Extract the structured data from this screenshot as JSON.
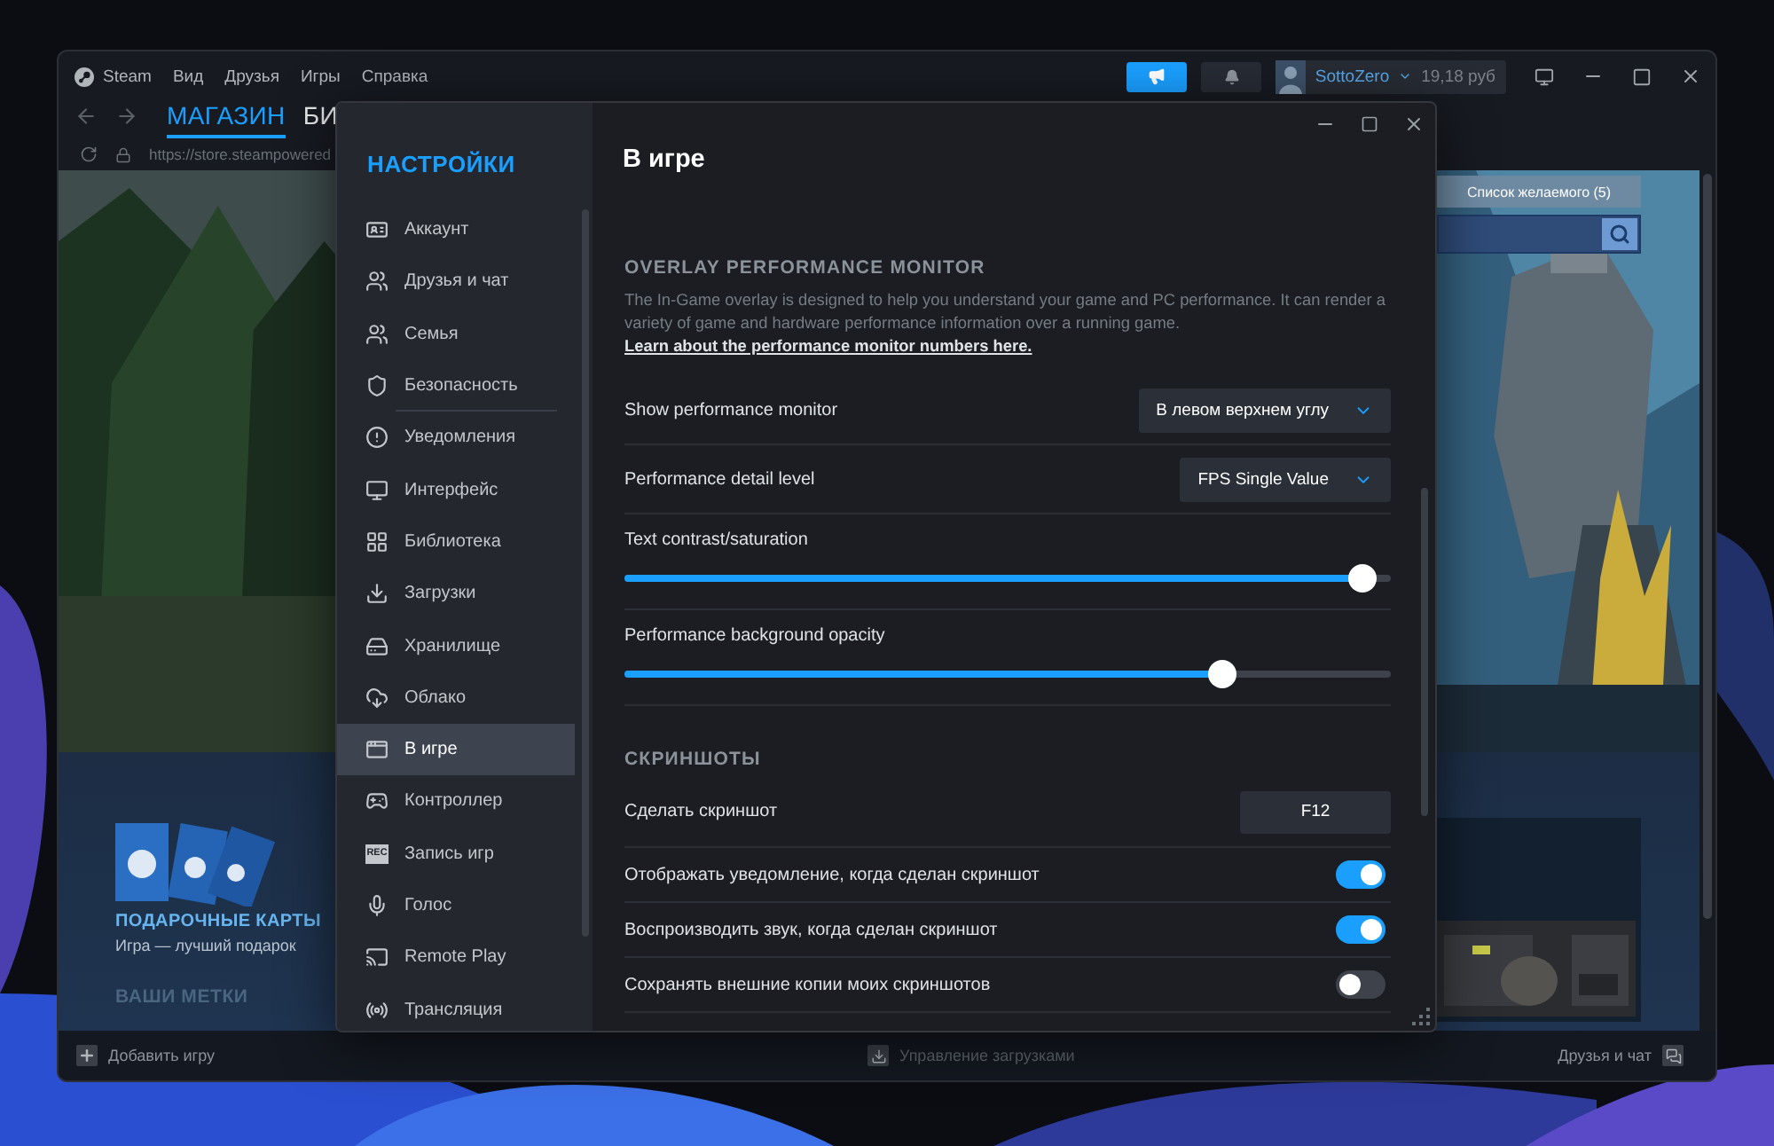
{
  "steam_window": {
    "menu": [
      {
        "label": "Steam"
      },
      {
        "label": "Вид"
      },
      {
        "label": "Друзья"
      },
      {
        "label": "Игры"
      },
      {
        "label": "Справка"
      }
    ],
    "account": {
      "name": "SottoZero",
      "balance": "19,18 руб"
    },
    "nav_tabs": [
      {
        "label": "МАГАЗИН",
        "selected": true
      },
      {
        "label": "БИ",
        "selected": false
      }
    ],
    "url": "https://store.steampowered",
    "store": {
      "wishlist_button": "Список желаемого (5)",
      "gift_title": "ПОДАРОЧНЫЕ КАРТЫ",
      "gift_subtitle": "Игра — лучший подарок",
      "tags_heading": "ВАШИ МЕТКИ"
    },
    "bottom_bar": {
      "add_game": "Добавить игру",
      "downloads": "Управление загрузками",
      "friends": "Друзья и чат"
    }
  },
  "settings": {
    "title": "НАСТРОЙКИ",
    "page_title": "В игре",
    "sidebar": [
      {
        "label": "Аккаунт",
        "selected": false,
        "group_end": false
      },
      {
        "label": "Друзья и чат",
        "selected": false,
        "group_end": false
      },
      {
        "label": "Семья",
        "selected": false,
        "group_end": false
      },
      {
        "label": "Безопасность",
        "selected": false,
        "group_end": true
      },
      {
        "label": "Уведомления",
        "selected": false,
        "group_end": false
      },
      {
        "label": "Интерфейс",
        "selected": false,
        "group_end": false
      },
      {
        "label": "Библиотека",
        "selected": false,
        "group_end": false
      },
      {
        "label": "Загрузки",
        "selected": false,
        "group_end": false
      },
      {
        "label": "Хранилище",
        "selected": false,
        "group_end": false
      },
      {
        "label": "Облако",
        "selected": false,
        "group_end": false
      },
      {
        "label": "В игре",
        "selected": true,
        "group_end": false
      },
      {
        "label": "Контроллер",
        "selected": false,
        "group_end": false
      },
      {
        "label": "Запись игр",
        "selected": false,
        "group_end": false,
        "badge": "REC"
      },
      {
        "label": "Голос",
        "selected": false,
        "group_end": false
      },
      {
        "label": "Remote Play",
        "selected": false,
        "group_end": false
      },
      {
        "label": "Трансляция",
        "selected": false,
        "group_end": false
      }
    ],
    "sections": [
      {
        "heading": "OVERLAY PERFORMANCE MONITOR",
        "description": "The In-Game overlay is designed to help you understand your game and PC performance. It can render a variety of game and hardware performance information over a running game.",
        "link": "Learn about the performance monitor numbers here.",
        "rows": [
          {
            "kind": "select",
            "label": "Show performance monitor",
            "value": "В левом верхнем углу"
          },
          {
            "kind": "select",
            "label": "Performance detail level",
            "value": "FPS Single Value"
          },
          {
            "kind": "slider",
            "label": "Text contrast/saturation",
            "level": 0.98
          },
          {
            "kind": "slider",
            "label": "Performance background opacity",
            "level": 0.79
          }
        ]
      },
      {
        "heading": "СКРИНШОТЫ",
        "rows": [
          {
            "kind": "key",
            "label": "Сделать скриншот",
            "value": "F12"
          },
          {
            "kind": "toggle",
            "label": "Отображать уведомление, когда сделан скриншот",
            "on": true
          },
          {
            "kind": "toggle",
            "label": "Воспроизводить звук, когда сделан скриншот",
            "on": true
          },
          {
            "kind": "toggle",
            "label": "Сохранять внешние копии моих скриншотов",
            "on": false
          }
        ]
      }
    ]
  }
}
